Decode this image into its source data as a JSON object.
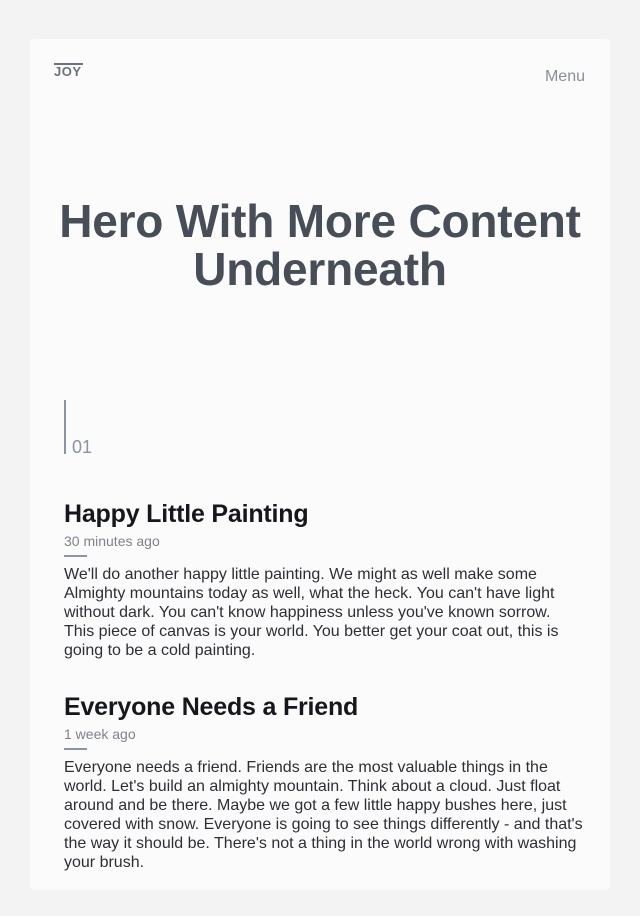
{
  "header": {
    "logo": "JOY",
    "menu_label": "Menu"
  },
  "hero": {
    "title": "Hero With More Content Underneath"
  },
  "section": {
    "counter": "01"
  },
  "posts": [
    {
      "title": "Happy Little Painting",
      "time": "30 minutes ago",
      "body": "We'll do another happy little painting. We might as well make some Almighty mountains today as well, what the heck. You can't have light without dark. You can't know happiness unless you've known sorrow. This piece of canvas is your world. You better get your coat out, this is going to be a cold painting."
    },
    {
      "title": "Everyone Needs a Friend",
      "time": "1 week ago",
      "body": "Everyone needs a friend. Friends are the most valuable things in the world. Let's build an almighty mountain. Think about a cloud. Just float around and be there. Maybe we got a few little happy bushes here, just covered with snow. Everyone is going to see things differently - and that's the way it should be. There's not a thing in the world wrong with washing your brush."
    }
  ]
}
